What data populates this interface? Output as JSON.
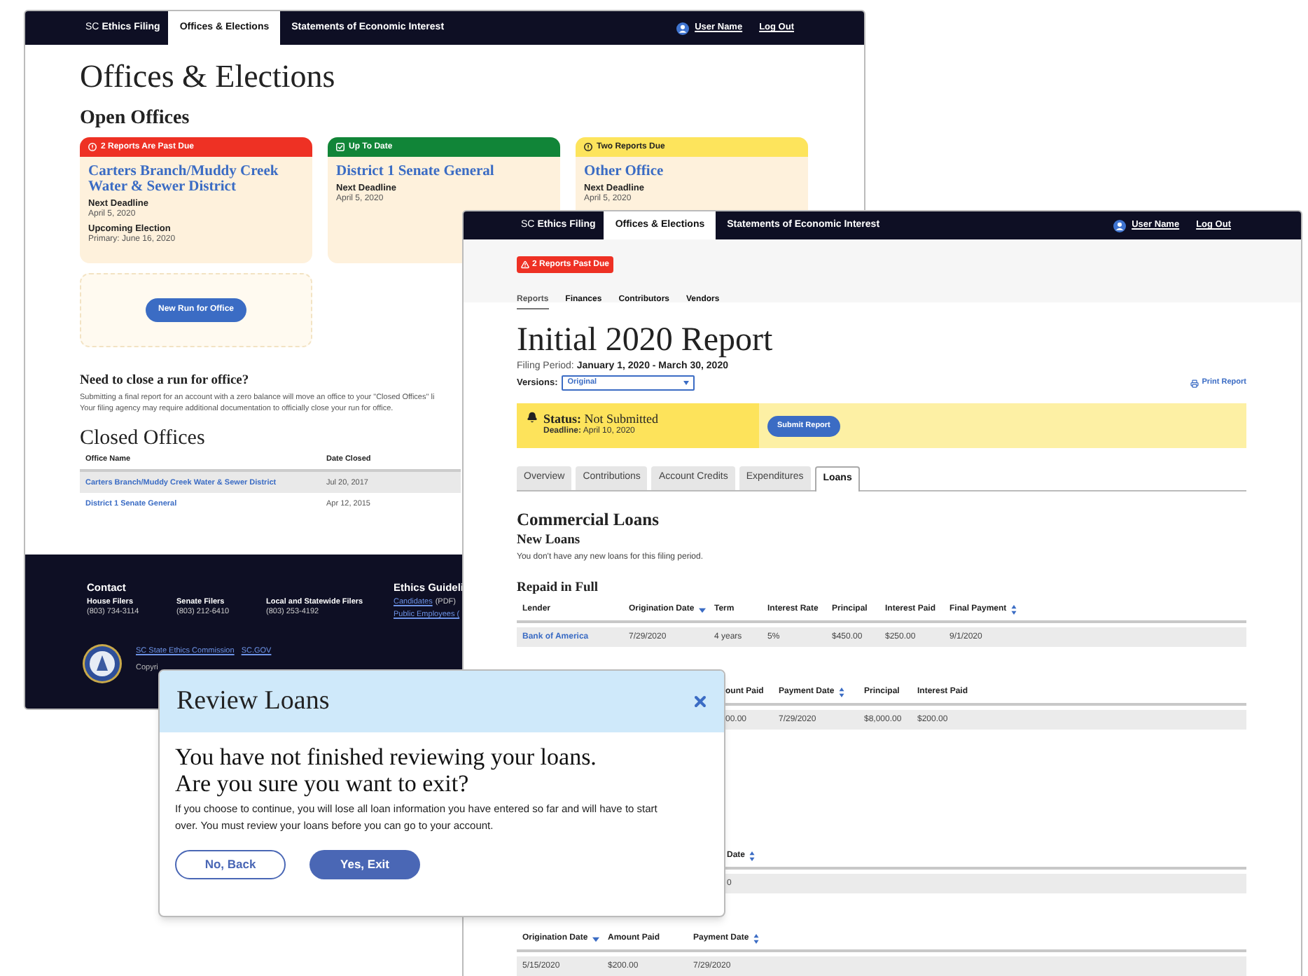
{
  "back_window": {
    "nav": {
      "brand_prefix": "SC",
      "brand": "Ethics Filing",
      "tabs": [
        {
          "label": "Offices & Elections",
          "selected": true
        },
        {
          "label": "Statements of Economic Interest",
          "selected": false
        }
      ],
      "user": "User Name",
      "logout": "Log Out"
    },
    "title": "Offices & Elections",
    "open_offices": {
      "heading": "Open Offices",
      "cards": [
        {
          "kind": "past_due",
          "status": "2 Reports Are Past Due",
          "name": "Carters Branch/Muddy Creek Water & Sewer District",
          "fields": [
            {
              "label": "Next Deadline",
              "value": "April 5, 2020"
            },
            {
              "label": "Upcoming Election",
              "value": "Primary: June 16, 2020"
            }
          ]
        },
        {
          "kind": "up_to_date",
          "status": "Up To Date",
          "name": "District 1 Senate General",
          "fields": [
            {
              "label": "Next Deadline",
              "value": "April 5, 2020"
            }
          ]
        },
        {
          "kind": "due",
          "status": "Two Reports Due",
          "name": "Other Office",
          "fields": [
            {
              "label": "Next Deadline",
              "value": "April 5, 2020"
            }
          ]
        }
      ],
      "new_run_button": "New Run for Office"
    },
    "close_info": {
      "heading": "Need to close a run for office?",
      "lines": [
        "Submitting a final report for an account with a zero balance will move an office to your \"Closed Offices\" li",
        "Your filing agency may require additional documentation to officially close your run for office."
      ]
    },
    "closed_offices": {
      "heading": "Closed Offices",
      "columns": [
        {
          "label": "Office Name",
          "kind": "link"
        },
        {
          "label": "Date Closed",
          "kind": "text"
        }
      ],
      "rows": [
        {
          "selected": true,
          "cells": [
            "Carters Branch/Muddy Creek Water & Sewer District",
            "Jul 20, 2017"
          ]
        },
        {
          "selected": false,
          "cells": [
            "District 1 Senate General",
            "Apr 12, 2015"
          ]
        }
      ]
    },
    "footer": {
      "contact_heading": "Contact",
      "groups": [
        {
          "label": "House Filers",
          "phone": "(803) 734-3114"
        },
        {
          "label": "Senate Filers",
          "phone": "(803) 212-6410"
        },
        {
          "label": "Local and Statewide Filers",
          "phone": "(803) 253-4192"
        }
      ],
      "guidelines_heading": "Ethics Guideli",
      "guidelines": [
        {
          "link": "Candidates",
          "note": "(PDF)"
        },
        {
          "link": "Public Employees ("
        }
      ],
      "bottom_links": [
        "SC State Ethics Commission",
        "SC.GOV"
      ],
      "copyright": "Copyri"
    }
  },
  "front_window": {
    "nav": {
      "brand_prefix": "SC",
      "brand": "Ethics Filing",
      "tabs": [
        {
          "label": "Offices & Elections",
          "selected": true
        },
        {
          "label": "Statements of Economic Interest",
          "selected": false
        }
      ],
      "user": "User Name",
      "logout": "Log Out"
    },
    "alert_badge": "2 Reports Past Due",
    "subnav": [
      {
        "label": "Reports",
        "selected": true
      },
      {
        "label": "Finances",
        "selected": false
      },
      {
        "label": "Contributors",
        "selected": false
      },
      {
        "label": "Vendors",
        "selected": false
      }
    ],
    "title": "Initial 2020 Report",
    "filing_period": {
      "label": "Filing Period:",
      "value": "January 1, 2020 - March 30, 2020"
    },
    "versions": {
      "label": "Versions:",
      "value": "Original"
    },
    "print_link": "Print Report",
    "status": {
      "label": "Status:",
      "value": "Not Submitted",
      "deadline_label": "Deadline:",
      "deadline": "April 10, 2020"
    },
    "submit_button": "Submit Report",
    "tabs": [
      {
        "label": "Overview",
        "selected": false
      },
      {
        "label": "Contributions",
        "selected": false
      },
      {
        "label": "Account Credits",
        "selected": false
      },
      {
        "label": "Expenditures",
        "selected": false
      },
      {
        "label": "Loans",
        "selected": true
      }
    ],
    "section_title": "Commercial Loans",
    "new_loans": {
      "heading": "New Loans",
      "message": "You don't have any new loans for this filing period."
    },
    "repaid": {
      "heading": "Repaid in Full",
      "columns": [
        {
          "label": "Lender",
          "kind": "link"
        },
        {
          "label": "Origination Date",
          "kind": "sort_desc"
        },
        {
          "label": "Term"
        },
        {
          "label": "Interest Rate"
        },
        {
          "label": "Principal"
        },
        {
          "label": "Interest Paid"
        },
        {
          "label": "Final Payment",
          "kind": "sort_both"
        }
      ],
      "rows": [
        [
          "Bank of America",
          "7/29/2020",
          "4 years",
          "5%",
          "$450.00",
          "$250.00",
          "9/1/2020"
        ]
      ]
    },
    "payments": {
      "columns": [
        {
          "label": "ount Paid"
        },
        {
          "label": "Payment Date",
          "kind": "sort_both"
        },
        {
          "label": "Principal"
        },
        {
          "label": "Interest Paid"
        }
      ],
      "rows": [
        [
          "00.00",
          "7/29/2020",
          "$8,000.00",
          "$200.00"
        ]
      ]
    },
    "partial_table": {
      "columns": [
        {
          "label": "Date",
          "kind": "sort_both"
        }
      ],
      "rows": [
        [
          "0"
        ]
      ]
    },
    "last_table": {
      "columns": [
        {
          "label": "Origination Date",
          "kind": "sort_desc"
        },
        {
          "label": "Amount Paid"
        },
        {
          "label": "Payment Date",
          "kind": "sort_both"
        }
      ],
      "rows": [
        [
          "5/15/2020",
          "$200.00",
          "7/29/2020"
        ]
      ]
    }
  },
  "modal": {
    "title": "Review Loans",
    "question": [
      "You have not finished reviewing your loans.",
      "Are you sure you want to exit?"
    ],
    "message": "If you choose to continue, you will lose all loan information you have entered so far and will have to start over. You must review your loans before you can go to your account.",
    "buttons": [
      {
        "label": "No, Back",
        "kind": "secondary"
      },
      {
        "label": "Yes, Exit",
        "kind": "primary"
      }
    ]
  }
}
